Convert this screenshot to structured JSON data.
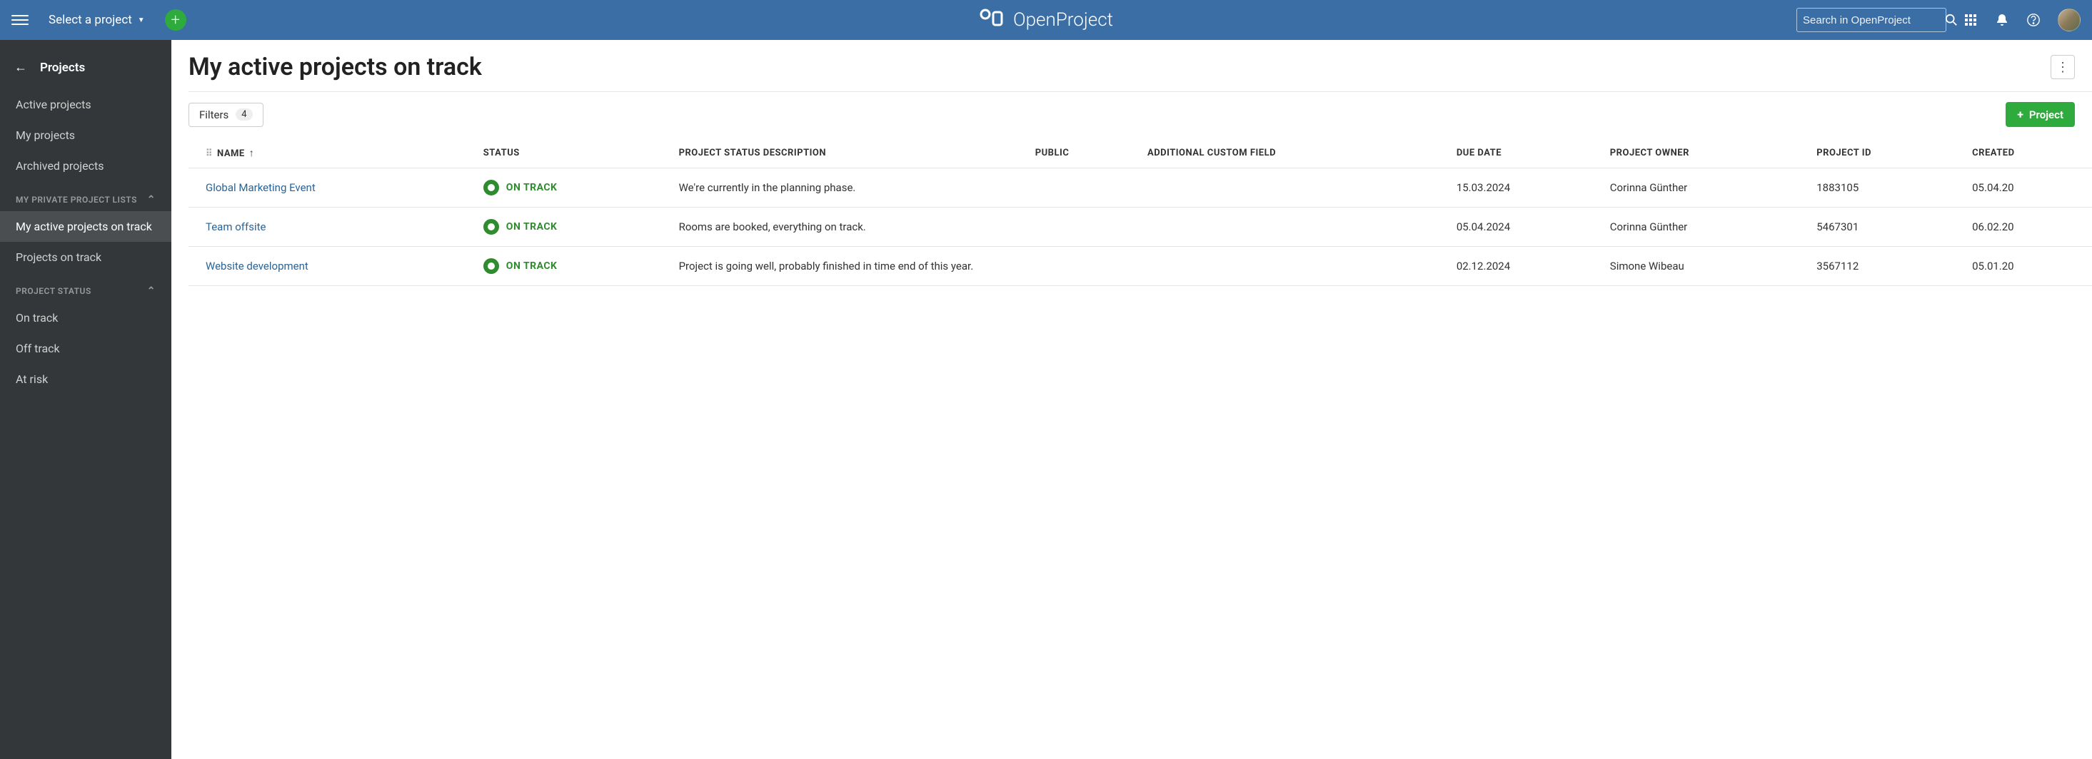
{
  "topbar": {
    "project_select": "Select a project",
    "brand": "OpenProject",
    "search_placeholder": "Search in OpenProject"
  },
  "sidebar": {
    "title": "Projects",
    "items_main": [
      "Active projects",
      "My projects",
      "Archived projects"
    ],
    "section_private": "MY PRIVATE PROJECT LISTS",
    "items_private": [
      "My active projects on track",
      "Projects on track"
    ],
    "active_private_index": 0,
    "section_status": "PROJECT STATUS",
    "items_status": [
      "On track",
      "Off track",
      "At risk"
    ]
  },
  "main": {
    "title": "My active projects on track",
    "filters_label": "Filters",
    "filters_count": "4",
    "new_project_label": "Project"
  },
  "table": {
    "columns": [
      "NAME",
      "STATUS",
      "PROJECT STATUS DESCRIPTION",
      "PUBLIC",
      "ADDITIONAL CUSTOM FIELD",
      "DUE DATE",
      "PROJECT OWNER",
      "PROJECT ID",
      "CREATED"
    ],
    "sort_col_index": 0,
    "rows": [
      {
        "name": "Global Marketing Event",
        "status": "ON TRACK",
        "desc": "We're currently in the planning phase.",
        "public": "",
        "custom": "",
        "due": "15.03.2024",
        "owner": "Corinna Günther",
        "id": "1883105",
        "created": "05.04.20"
      },
      {
        "name": "Team offsite",
        "status": "ON TRACK",
        "desc": "Rooms are booked, everything on track.",
        "public": "",
        "custom": "",
        "due": "05.04.2024",
        "owner": "Corinna Günther",
        "id": "5467301",
        "created": "06.02.20"
      },
      {
        "name": "Website development",
        "status": "ON TRACK",
        "desc": "Project is going well, probably finished in time end of this year.",
        "public": "",
        "custom": "",
        "due": "02.12.2024",
        "owner": "Simone Wibeau",
        "id": "3567112",
        "created": "05.01.20"
      }
    ]
  }
}
